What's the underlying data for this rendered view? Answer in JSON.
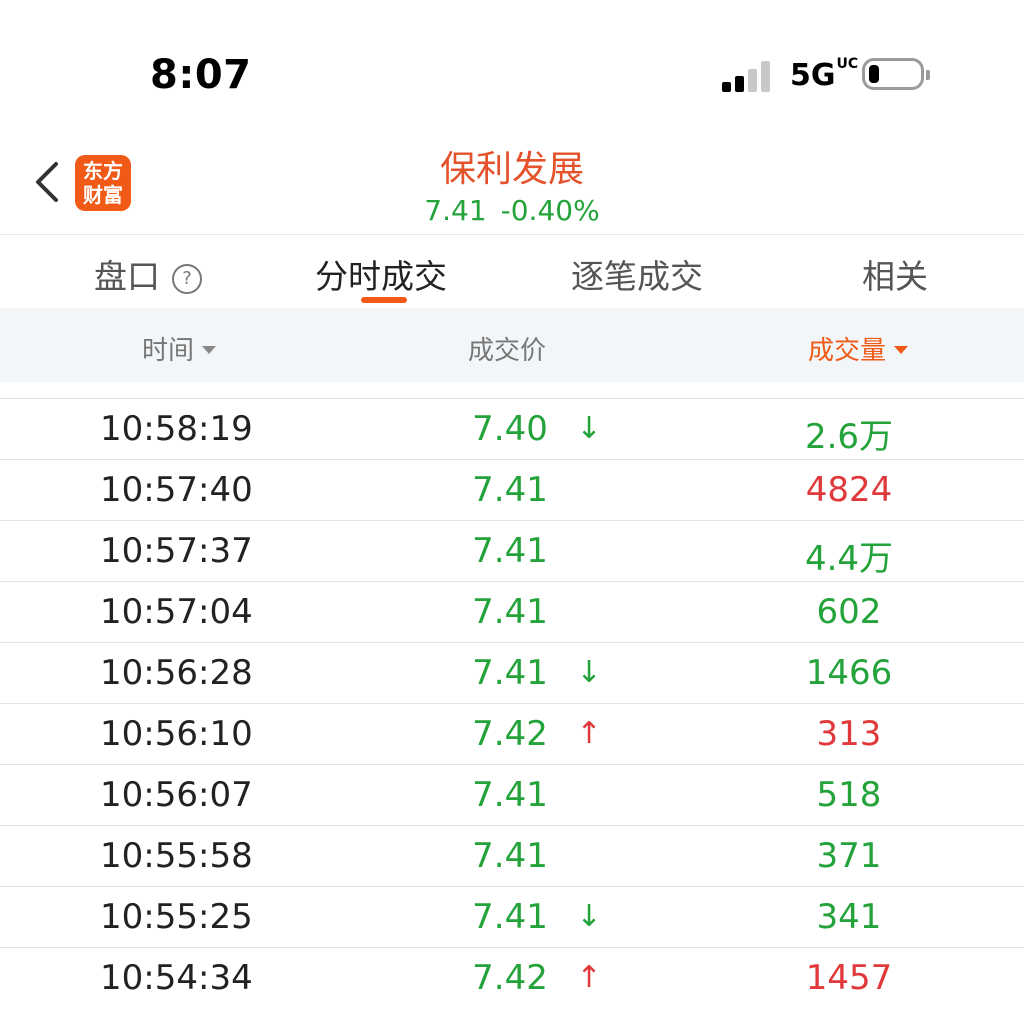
{
  "status": {
    "time": "8:07",
    "network": "5G",
    "network_sup": "UC"
  },
  "header": {
    "logo_line1": "东方",
    "logo_line2": "财富",
    "stock_name": "保利发展",
    "price": "7.41",
    "change": "-0.40%"
  },
  "tabs": [
    {
      "label": "盘口"
    },
    {
      "label": "分时成交"
    },
    {
      "label": "逐笔成交"
    },
    {
      "label": "相关"
    }
  ],
  "columns": {
    "time": "时间",
    "price": "成交价",
    "volume": "成交量"
  },
  "colors": {
    "accent": "#f05a16",
    "up": "#e0393b",
    "down": "#23a33a",
    "title": "#e3522a"
  },
  "trades": [
    {
      "time": "10:58:19",
      "price": "7.40",
      "arrow": "↓",
      "volume": "2.6万",
      "vol_color": "green",
      "arrow_color": "green"
    },
    {
      "time": "10:57:40",
      "price": "7.41",
      "arrow": "",
      "volume": "4824",
      "vol_color": "red",
      "arrow_color": "green"
    },
    {
      "time": "10:57:37",
      "price": "7.41",
      "arrow": "",
      "volume": "4.4万",
      "vol_color": "green",
      "arrow_color": "green"
    },
    {
      "time": "10:57:04",
      "price": "7.41",
      "arrow": "",
      "volume": "602",
      "vol_color": "green",
      "arrow_color": "green"
    },
    {
      "time": "10:56:28",
      "price": "7.41",
      "arrow": "↓",
      "volume": "1466",
      "vol_color": "green",
      "arrow_color": "green"
    },
    {
      "time": "10:56:10",
      "price": "7.42",
      "arrow": "↑",
      "volume": "313",
      "vol_color": "red",
      "arrow_color": "red"
    },
    {
      "time": "10:56:07",
      "price": "7.41",
      "arrow": "",
      "volume": "518",
      "vol_color": "green",
      "arrow_color": "green"
    },
    {
      "time": "10:55:58",
      "price": "7.41",
      "arrow": "",
      "volume": "371",
      "vol_color": "green",
      "arrow_color": "green"
    },
    {
      "time": "10:55:25",
      "price": "7.41",
      "arrow": "↓",
      "volume": "341",
      "vol_color": "green",
      "arrow_color": "green"
    },
    {
      "time": "10:54:34",
      "price": "7.42",
      "arrow": "↑",
      "volume": "1457",
      "vol_color": "red",
      "arrow_color": "red"
    }
  ]
}
